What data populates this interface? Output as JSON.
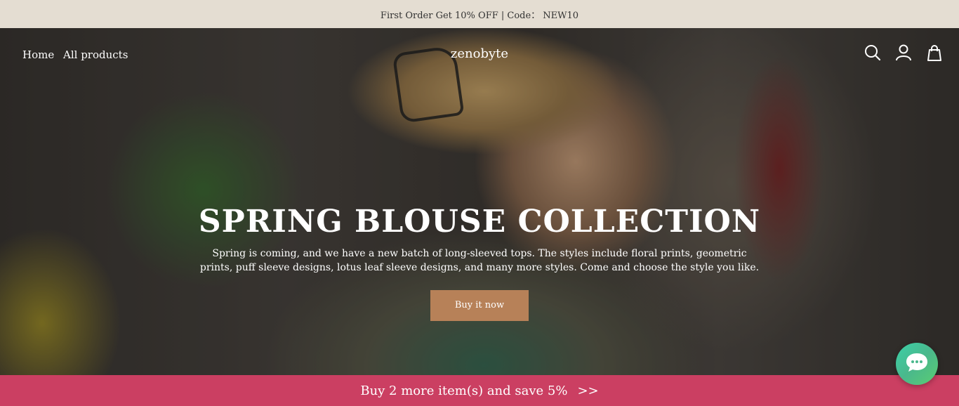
{
  "announcement": {
    "text": "First Order Get 10% OFF | Code： NEW10"
  },
  "nav": {
    "links": [
      "Home",
      "All products"
    ],
    "logo": "zenobyte",
    "icons": [
      "search-icon",
      "account-icon",
      "cart-icon"
    ]
  },
  "hero": {
    "title": "SPRING BLOUSE COLLECTION",
    "description": "Spring is coming, and we have a new batch of long-sleeved tops. The styles include floral prints, geometric prints, puff sleeve designs, lotus leaf sleeve designs, and many more styles. Come and choose the style you like.",
    "button": "Buy it now"
  },
  "promo_bar": {
    "text": "Buy 2 more item(s) and save 5%",
    "arrow": ">>"
  },
  "chat": {
    "icon": "chat-icon"
  },
  "colors": {
    "announcement_bg": "#e4ddd2",
    "button_bg": "#b78158",
    "promo_bg": "#cb3f62",
    "chat_bg": "#4ab88c"
  }
}
